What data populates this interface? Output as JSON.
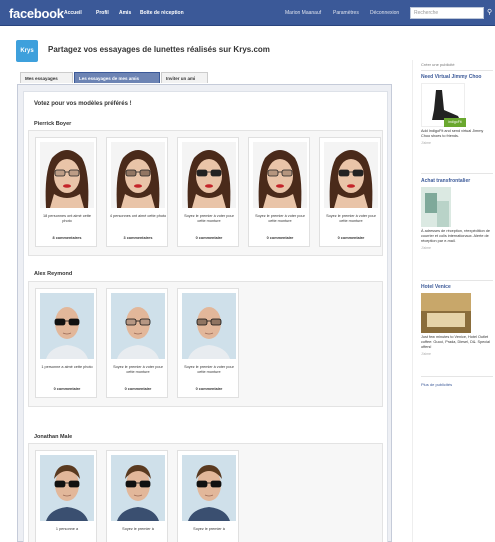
{
  "topbar": {
    "logo": "facebook",
    "nav": [
      "Accueil",
      "Profil",
      "Amis",
      "Boîte de réception"
    ],
    "user": "Marion Maanauf",
    "settings": "Paramètres",
    "logout": "Déconnexion",
    "search_placeholder": "Recherche"
  },
  "app": {
    "logo_text": "Krys",
    "title": "Partagez vos essayages de lunettes réalisés sur Krys.com",
    "tabs": [
      "Mes essayages",
      "Les essayages de mes amis",
      "Inviter un ami"
    ],
    "active_tab": 1,
    "heading": "Votez pour vos modèles préférés !"
  },
  "groups": [
    {
      "name": "Pierrick Boyer",
      "cards": [
        {
          "caption": "18 personnes ont aimé cette photo",
          "comments": "8 commentaires"
        },
        {
          "caption": "4 personnes ont aimé cette photo",
          "comments": "3 commentaires"
        },
        {
          "caption": "Soyez le premier à voter pour cette monture",
          "comments": "0 commentaire"
        },
        {
          "caption": "Soyez le premier à voter pour cette monture",
          "comments": "0 commentaire"
        },
        {
          "caption": "Soyez le premier à voter pour cette monture",
          "comments": "0 commentaire"
        }
      ]
    },
    {
      "name": "Alex Reymond",
      "cards": [
        {
          "caption": "1 personne a aimé cette photo",
          "comments": "0 commentaire"
        },
        {
          "caption": "Soyez le premier à voter pour cette monture",
          "comments": "0 commentaire"
        },
        {
          "caption": "Soyez le premier à voter pour cette monture",
          "comments": "0 commentaire"
        }
      ]
    },
    {
      "name": "Jonathan Male",
      "cards": [
        {
          "caption": "1 personne a",
          "comments": ""
        },
        {
          "caption": "Soyez le premier à",
          "comments": ""
        },
        {
          "caption": "Soyez le premier à",
          "comments": ""
        }
      ]
    }
  ],
  "sidebar": {
    "create_ad": "Créer une publicité",
    "ads": [
      {
        "title": "Need Virtual Jimmy Choo",
        "badge": "indigoFit",
        "desc": "Add IndigoFit and send virtual Jimmy Choo shoes to friends.",
        "like": "J'aime"
      },
      {
        "title": "Achat transfrontalier",
        "desc": "À adresses de réception, réexpédition de courrier et colis internationaux. Alerte de réception par e-mail.",
        "like": "J'aime"
      },
      {
        "title": "Hotel Venice",
        "desc": "Just few minutes to Venice, Hotel Outlet coffee: Gucci, Prada, Diesel, D&. Special offers!",
        "like": "J'aime"
      }
    ],
    "more": "Plus de publicités"
  },
  "colors": {
    "fb_blue": "#3b5998",
    "tab_active": "#6d84b4",
    "krys_blue": "#3ea0dc"
  }
}
